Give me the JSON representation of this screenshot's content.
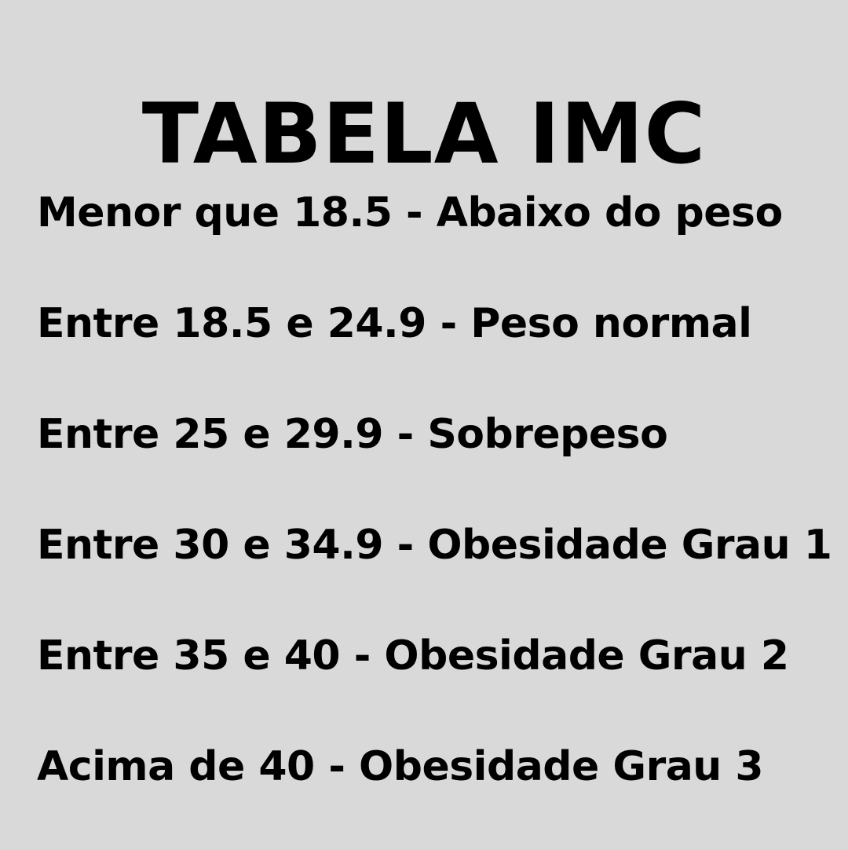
{
  "title": "TABELA IMC",
  "rows": [
    "Menor que 18.5 - Abaixo do peso",
    "Entre 18.5 e 24.9 - Peso normal",
    "Entre 25 e 29.9 - Sobrepeso",
    "Entre 30 e 34.9 - Obesidade Grau 1",
    "Entre 35 e 40 - Obesidade Grau 2",
    "Acima de 40 - Obesidade Grau 3"
  ],
  "colors": {
    "background": "#d9d9d9",
    "text": "#000000"
  }
}
